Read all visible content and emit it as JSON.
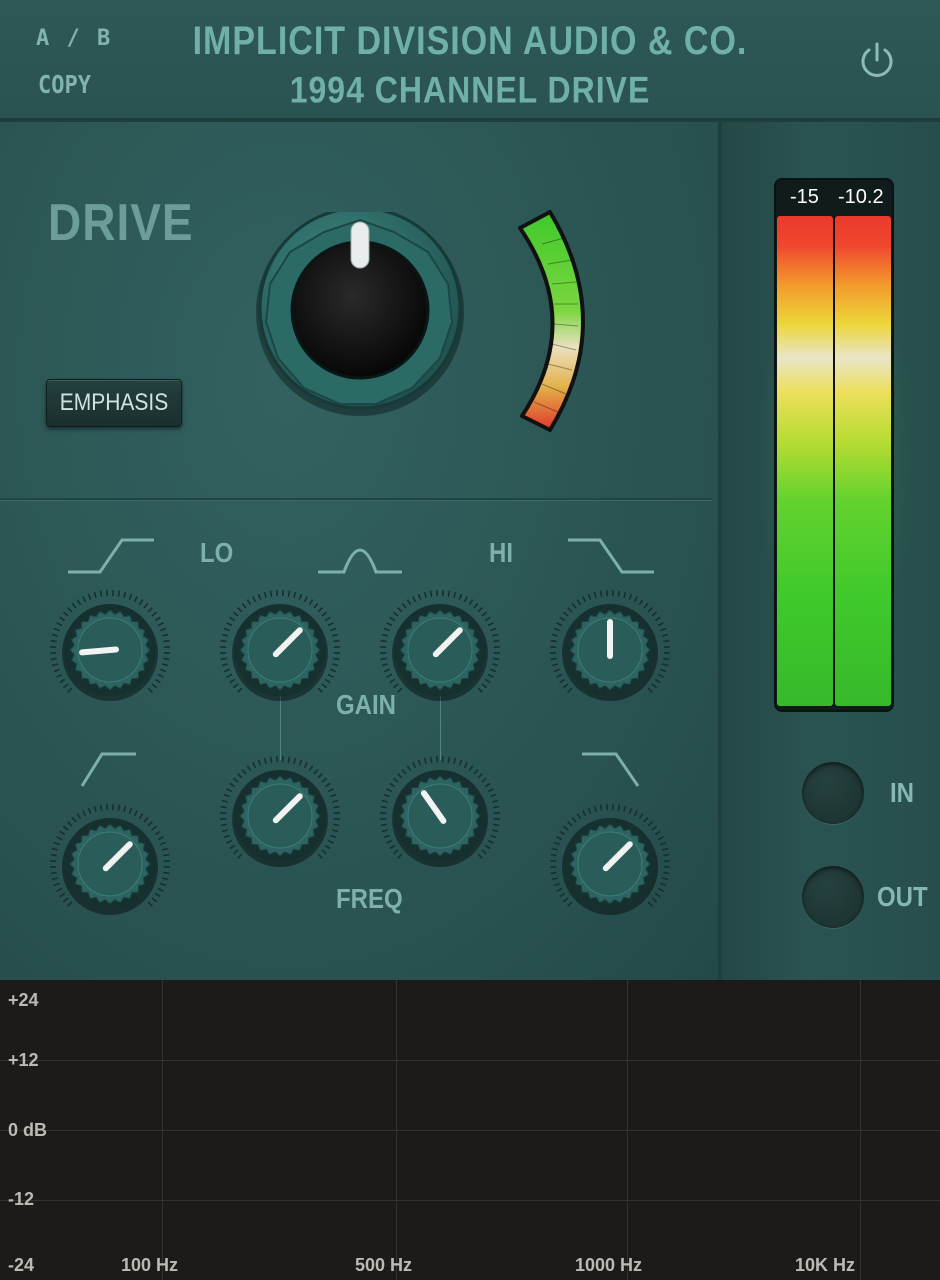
{
  "header": {
    "ab_label": "A / B",
    "copy_label": "COPY",
    "brand": "IMPLICIT DIVISION AUDIO & CO.",
    "model": "1994 CHANNEL DRIVE",
    "power_icon": "power-icon"
  },
  "drive": {
    "label": "DRIVE",
    "emphasis_label": "EMPHASIS",
    "knob_value_fraction": 0.5
  },
  "eq": {
    "lo_label": "LO",
    "hi_label": "HI",
    "gain_label": "GAIN",
    "freq_label": "FREQ",
    "shape_icons": [
      "high-pass-shape-icon",
      "bell-shape-icon",
      "low-pass-shape-icon",
      "low-shelf-shape-icon",
      "high-shelf-shape-icon"
    ]
  },
  "output_meter": {
    "left_reading": "-15",
    "right_reading": "-10.2"
  },
  "io": {
    "in_label": "IN",
    "out_label": "OUT"
  },
  "graph": {
    "y_labels": [
      "+24",
      "+12",
      "0 dB",
      "-12",
      "-24"
    ],
    "x_labels": [
      "100 Hz",
      "500 Hz",
      "1000 Hz",
      "10K Hz"
    ]
  },
  "colors": {
    "panel": "#2b5553",
    "knob_teal": "#2d6360",
    "label_teal": "#6fb1a8",
    "graph_bg": "#1c1b1a"
  }
}
